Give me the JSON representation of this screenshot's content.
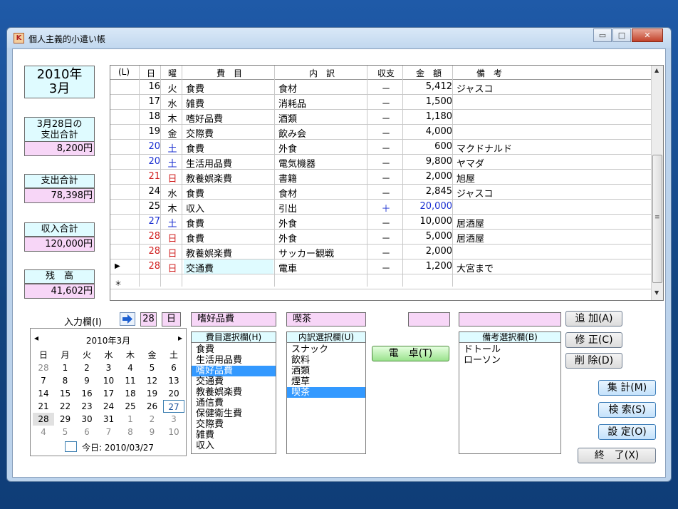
{
  "window": {
    "title": "個人主義的小遣い帳",
    "btn_min": "▭",
    "btn_max": "□",
    "btn_close": "✕"
  },
  "side": {
    "year_month_line1": "2010年",
    "year_month_line2": "3月",
    "day_total_label1": "3月28日の",
    "day_total_label2": "支出合計",
    "day_total_value": "8,200円",
    "expense_total_label": "支出合計",
    "expense_total_value": "78,398円",
    "income_total_label": "収入合計",
    "income_total_value": "120,000円",
    "balance_label": "残　高",
    "balance_value": "41,602円"
  },
  "grid": {
    "headers": [
      "(L)",
      "日",
      "曜",
      "費　目",
      "内　訳",
      "収支",
      "金　額",
      "備　考"
    ],
    "rows": [
      {
        "day": "16",
        "dow": "火",
        "cat": "食費",
        "item": "食材",
        "type": "－",
        "amount": "5,412",
        "note": "ジャスコ",
        "marker": ""
      },
      {
        "day": "17",
        "dow": "水",
        "cat": "雑費",
        "item": "消耗品",
        "type": "－",
        "amount": "1,500",
        "note": "",
        "marker": ""
      },
      {
        "day": "18",
        "dow": "木",
        "cat": "嗜好品費",
        "item": "酒類",
        "type": "－",
        "amount": "1,180",
        "note": "",
        "marker": ""
      },
      {
        "day": "19",
        "dow": "金",
        "cat": "交際費",
        "item": "飲み会",
        "type": "－",
        "amount": "4,000",
        "note": "",
        "marker": ""
      },
      {
        "day": "20",
        "dow": "土",
        "cat": "食費",
        "item": "外食",
        "type": "－",
        "amount": "600",
        "note": "マクドナルド",
        "marker": ""
      },
      {
        "day": "20",
        "dow": "土",
        "cat": "生活用品費",
        "item": "電気機器",
        "type": "－",
        "amount": "9,800",
        "note": "ヤマダ",
        "marker": ""
      },
      {
        "day": "21",
        "dow": "日",
        "cat": "教養娯楽費",
        "item": "書籍",
        "type": "－",
        "amount": "2,000",
        "note": "旭屋",
        "marker": ""
      },
      {
        "day": "24",
        "dow": "水",
        "cat": "食費",
        "item": "食材",
        "type": "－",
        "amount": "2,845",
        "note": "ジャスコ",
        "marker": ""
      },
      {
        "day": "25",
        "dow": "木",
        "cat": "収入",
        "item": "引出",
        "type": "＋",
        "amount": "20,000",
        "note": "",
        "marker": ""
      },
      {
        "day": "27",
        "dow": "土",
        "cat": "食費",
        "item": "外食",
        "type": "－",
        "amount": "10,000",
        "note": "居酒屋",
        "marker": ""
      },
      {
        "day": "28",
        "dow": "日",
        "cat": "食費",
        "item": "外食",
        "type": "－",
        "amount": "5,000",
        "note": "居酒屋",
        "marker": ""
      },
      {
        "day": "28",
        "dow": "日",
        "cat": "教養娯楽費",
        "item": "サッカー観戦",
        "type": "－",
        "amount": "2,000",
        "note": "",
        "marker": ""
      },
      {
        "day": "28",
        "dow": "日",
        "cat": "交通費",
        "item": "電車",
        "type": "－",
        "amount": "1,200",
        "note": "大宮まで",
        "marker": "▶"
      },
      {
        "day": "",
        "dow": "",
        "cat": "",
        "item": "",
        "type": "",
        "amount": "",
        "note": "",
        "marker": "＊"
      }
    ],
    "scroll_up": "▲",
    "scroll_down": "▼",
    "scroll_grip": "≡"
  },
  "input": {
    "label": "入力欄(I)",
    "day": "28",
    "dow": "日",
    "category": "嗜好品費",
    "item": "喫茶",
    "amount": "",
    "note": ""
  },
  "lists": {
    "category_header": "費目選択欄(H)",
    "categories": [
      "食費",
      "生活用品費",
      "嗜好品費",
      "交通費",
      "教養娯楽費",
      "通信費",
      "保健衛生費",
      "交際費",
      "雑費",
      "収入"
    ],
    "category_selected": 2,
    "item_header": "内訳選択欄(U)",
    "items": [
      "スナック",
      "飲料",
      "酒類",
      "煙草",
      "喫茶"
    ],
    "item_selected": 4,
    "note_header": "備考選択欄(B)",
    "notes": [
      "ドトール",
      "ローソン"
    ]
  },
  "buttons": {
    "calculator": "電　卓(T)",
    "add": "追 加(A)",
    "edit": "修 正(C)",
    "delete": "削 除(D)",
    "summary": "集 計(M)",
    "search": "検 索(S)",
    "settings": "設 定(O)",
    "exit": "終　了(X)"
  },
  "calendar": {
    "month_label": "2010年3月",
    "prev": "◂",
    "next": "▸",
    "weekdays": [
      "日",
      "月",
      "火",
      "水",
      "木",
      "金",
      "土"
    ],
    "weeks": [
      [
        "28",
        "1",
        "2",
        "3",
        "4",
        "5",
        "6"
      ],
      [
        "7",
        "8",
        "9",
        "10",
        "11",
        "12",
        "13"
      ],
      [
        "14",
        "15",
        "16",
        "17",
        "18",
        "19",
        "20"
      ],
      [
        "21",
        "22",
        "23",
        "24",
        "25",
        "26",
        "27"
      ],
      [
        "28",
        "29",
        "30",
        "31",
        "1",
        "2",
        "3"
      ],
      [
        "4",
        "5",
        "6",
        "7",
        "8",
        "9",
        "10"
      ]
    ],
    "today_label": "今日: 2010/03/27"
  },
  "colors": {
    "blue_text": "#1a2fd0",
    "red_text": "#d02020",
    "cyan_box": "#dffbff",
    "pink_box": "#f7d6f7",
    "selection": "#3399ff"
  }
}
